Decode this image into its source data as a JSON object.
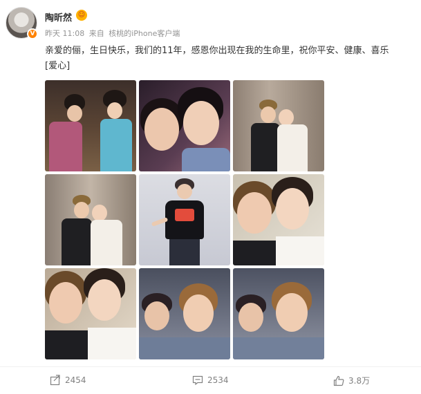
{
  "post": {
    "user_name": "陶昕然",
    "badge_icon": "smiley-badge-icon",
    "time": "昨天 11:08",
    "source_prefix": "来自",
    "source": "核桃的iPhone客户端",
    "text": "亲爱的俪，生日快乐，我们的11年，感恩你出现在我的生命里，祝你平安、健康、喜乐",
    "text_emoji": "[爱心]"
  },
  "images": [
    "photo-1",
    "photo-2",
    "photo-3",
    "photo-4",
    "photo-5",
    "photo-6",
    "photo-7",
    "photo-8",
    "photo-9"
  ],
  "actions": {
    "repost_count": "2454",
    "comment_count": "2534",
    "like_count": "3.8万"
  },
  "colors": {
    "verified": "#ff8200",
    "meta_text": "#939393",
    "action_text": "#808080"
  }
}
